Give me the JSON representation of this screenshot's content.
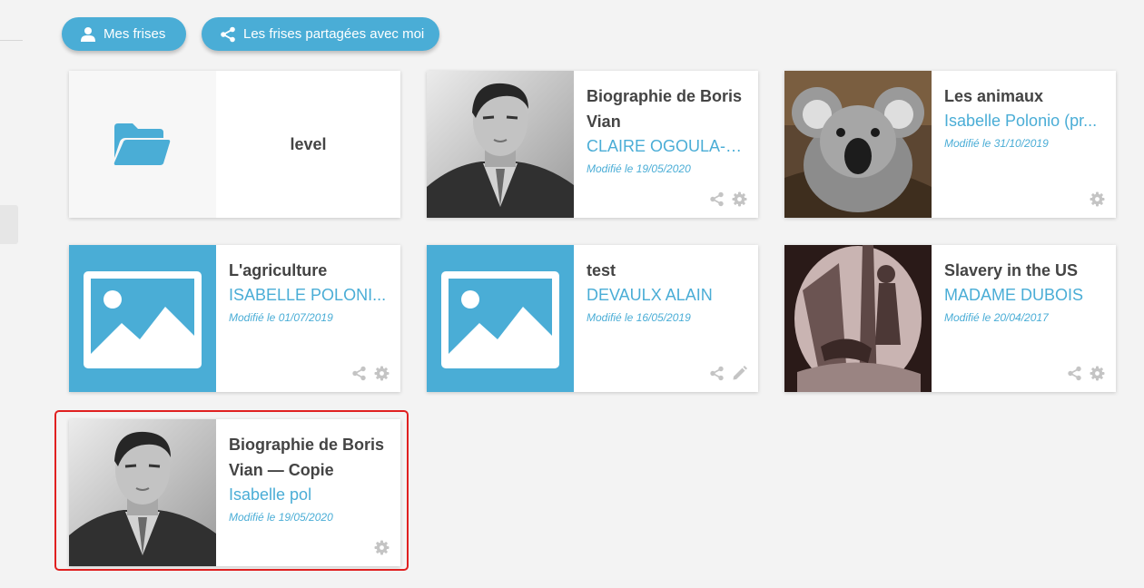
{
  "toolbar": {
    "my_timelines": "Mes frises",
    "shared_with_me": "Les frises partagées avec moi"
  },
  "folder": {
    "name": "level"
  },
  "cards": [
    {
      "title": "Biographie de Boris Vian",
      "author": "CLAIRE OGOULA-N...",
      "date": "Modifié le 19/05/2020",
      "thumb": "portrait",
      "actions": [
        "share-icon",
        "gear-icon"
      ]
    },
    {
      "title": "Les animaux",
      "author": "Isabelle Polonio (pr...",
      "date": "Modifié le 31/10/2019",
      "thumb": "koala",
      "actions": [
        "gear-icon"
      ]
    },
    {
      "title": "L'agriculture",
      "author": "ISABELLE POLONI...",
      "date": "Modifié le 01/07/2019",
      "thumb": "placeholder",
      "actions": [
        "share-icon",
        "gear-icon"
      ]
    },
    {
      "title": "test",
      "author": "DEVAULX ALAIN",
      "date": "Modifié le 16/05/2019",
      "thumb": "placeholder",
      "actions": [
        "share-icon",
        "pencil-icon"
      ]
    },
    {
      "title": "Slavery in the US",
      "author": "MADAME DUBOIS",
      "date": "Modifié le 20/04/2017",
      "thumb": "engraving",
      "actions": [
        "share-icon",
        "gear-icon"
      ]
    },
    {
      "title": "Biographie de Boris Vian — Copie",
      "author": "Isabelle pol",
      "date": "Modifié le 19/05/2020",
      "thumb": "portrait",
      "actions": [
        "gear-icon"
      ]
    }
  ],
  "colors": {
    "accent": "#4aadd6",
    "title": "#444444",
    "action_icon": "#c4c4c4",
    "selection": "#e02020"
  },
  "selected_card": 5
}
